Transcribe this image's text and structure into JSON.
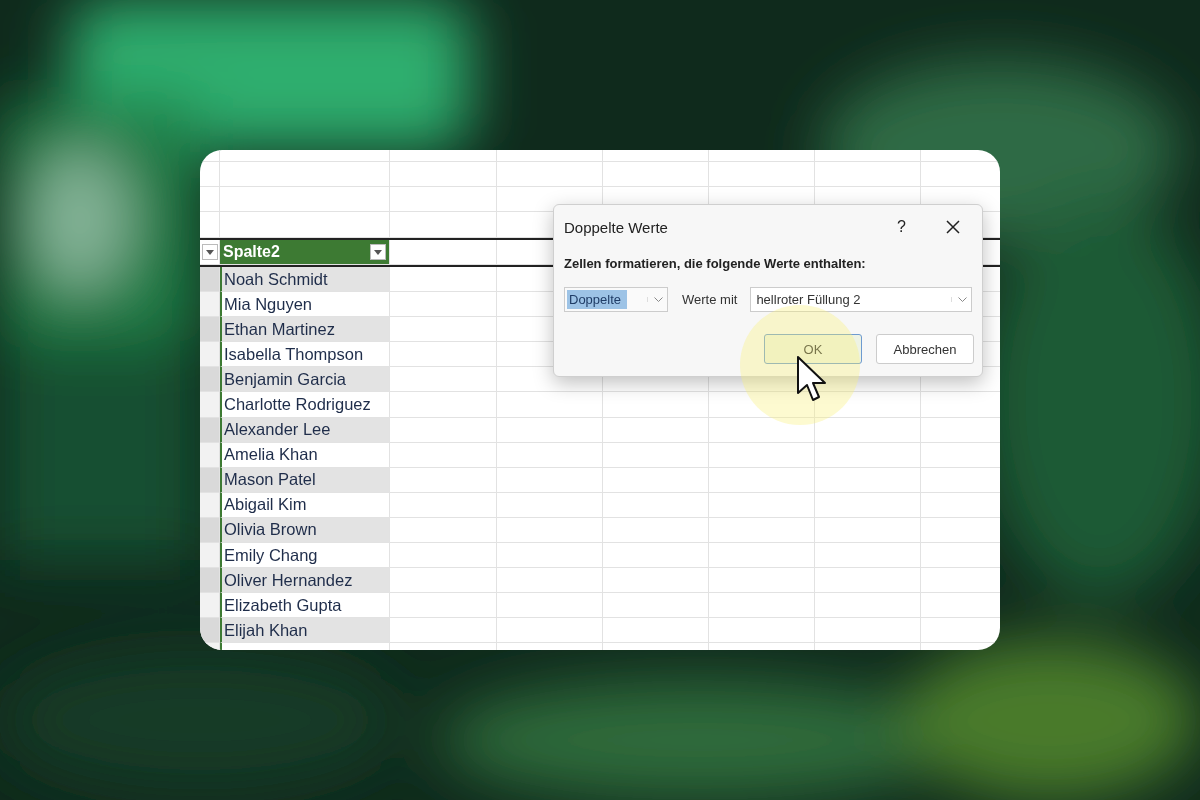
{
  "sheet": {
    "header": {
      "label": "Spalte2"
    },
    "rows": [
      "Noah Schmidt",
      "Mia Nguyen",
      "Ethan Martinez",
      "Isabella Thompson",
      "Benjamin Garcia",
      "Charlotte Rodriguez",
      "Alexander Lee",
      "Amelia Khan",
      "Mason Patel",
      "Abigail Kim",
      "Olivia Brown",
      "Emily Chang",
      "Oliver Hernandez",
      "Elizabeth Gupta",
      "Elijah Khan"
    ]
  },
  "dialog": {
    "title": "Doppelte Werte",
    "help": "?",
    "instruction": "Zellen formatieren, die folgende Werte enthalten:",
    "rule_dropdown": {
      "value": "Doppelte"
    },
    "connector": "Werte mit",
    "format_dropdown": {
      "value": "hellroter Füllung 2"
    },
    "buttons": [
      {
        "label": "OK",
        "kind": "primary"
      },
      {
        "label": "Abbrechen",
        "kind": "secondary"
      }
    ]
  }
}
